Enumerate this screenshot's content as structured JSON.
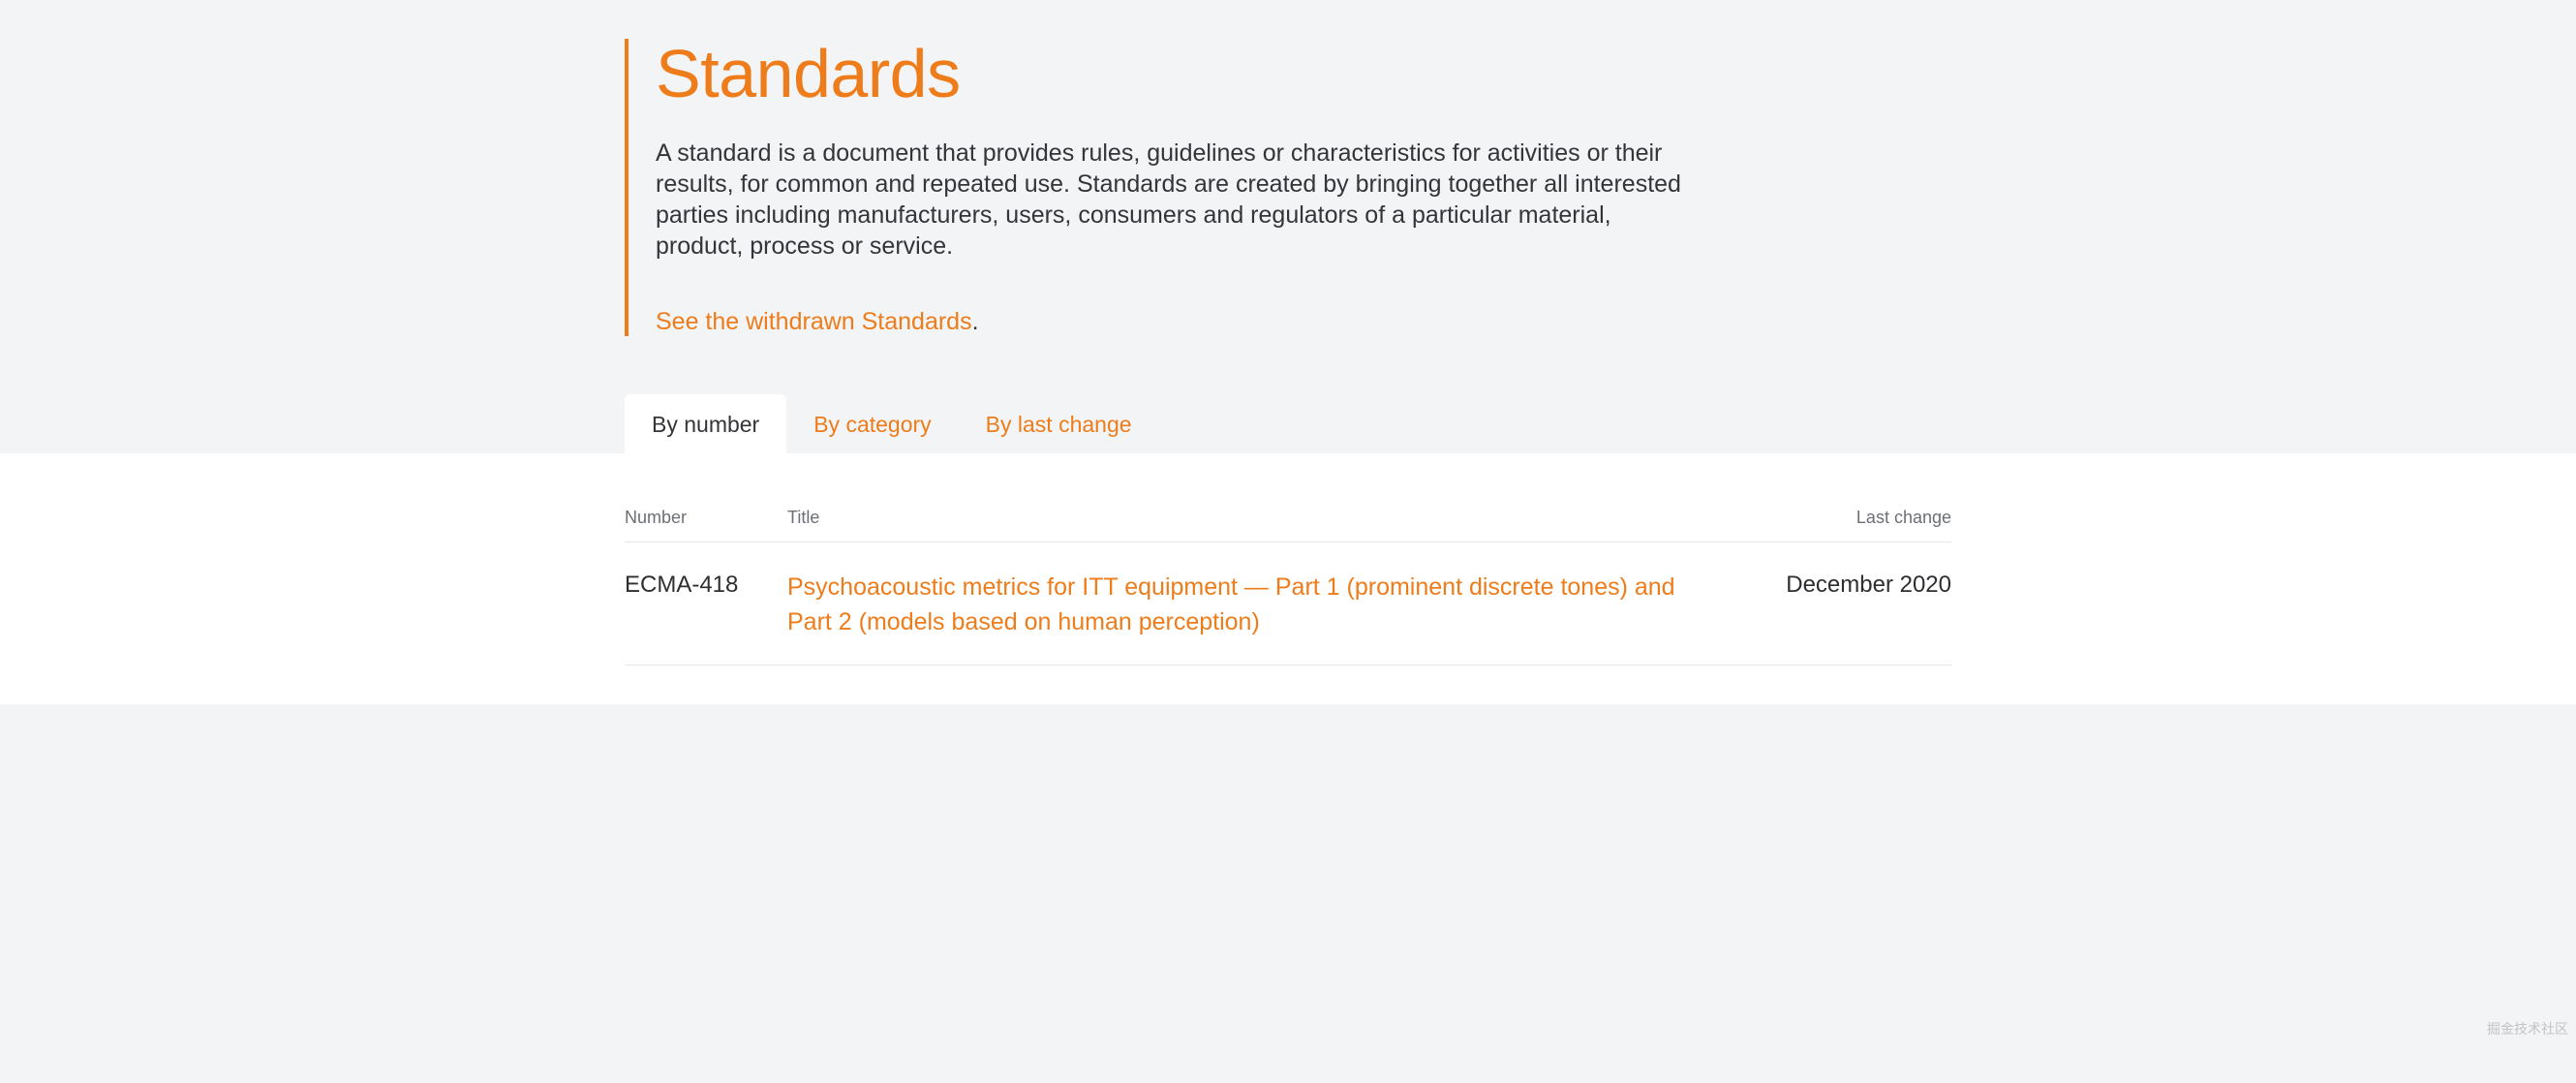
{
  "header": {
    "title": "Standards",
    "description": "A standard is a document that provides rules, guidelines or characteristics for activities or their results, for common and repeated use. Standards are created by bringing together all interested parties including manufacturers, users, consumers and regulators of a particular material, product, process or service.",
    "withdrawn_link": "See the withdrawn Standards",
    "withdrawn_suffix": "."
  },
  "tabs": [
    {
      "id": "by-number",
      "label": "By number",
      "active": true
    },
    {
      "id": "by-category",
      "label": "By category",
      "active": false
    },
    {
      "id": "by-last-change",
      "label": "By last change",
      "active": false
    }
  ],
  "table": {
    "columns": {
      "number": "Number",
      "title": "Title",
      "last_change": "Last change"
    },
    "rows": [
      {
        "number": "ECMA-418",
        "title_link": "Psychoacoustic metrics for ITT equipment — Part 1 (prominent discrete tones) and Part 2 (models based on human perception)",
        "last_change": "December 2020"
      }
    ]
  },
  "watermark": "掘金技术社区"
}
